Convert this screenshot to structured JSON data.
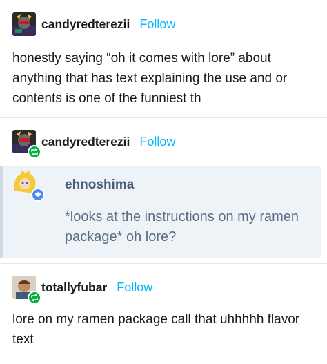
{
  "posts": [
    {
      "username": "candyredterezii",
      "follow_label": "Follow",
      "body": "honestly saying “oh it comes with lore” about anything that has text explaining the use and or contents is one of the funniest th"
    },
    {
      "username": "candyredterezii",
      "follow_label": "Follow",
      "quote": {
        "username": "ehnoshima",
        "text": "*looks at the instructions on my ramen package* oh lore?"
      }
    },
    {
      "username": "totallyfubar",
      "follow_label": "Follow",
      "body": "lore on my ramen package call that uhhhhh flavor text"
    }
  ],
  "icons": {
    "reblog": "reblog-icon",
    "message": "message-icon"
  },
  "colors": {
    "follow": "#00b8ff",
    "reblog_badge": "#00b13a",
    "quote_bg": "#eef3f8",
    "quote_text": "#5a6d84"
  }
}
